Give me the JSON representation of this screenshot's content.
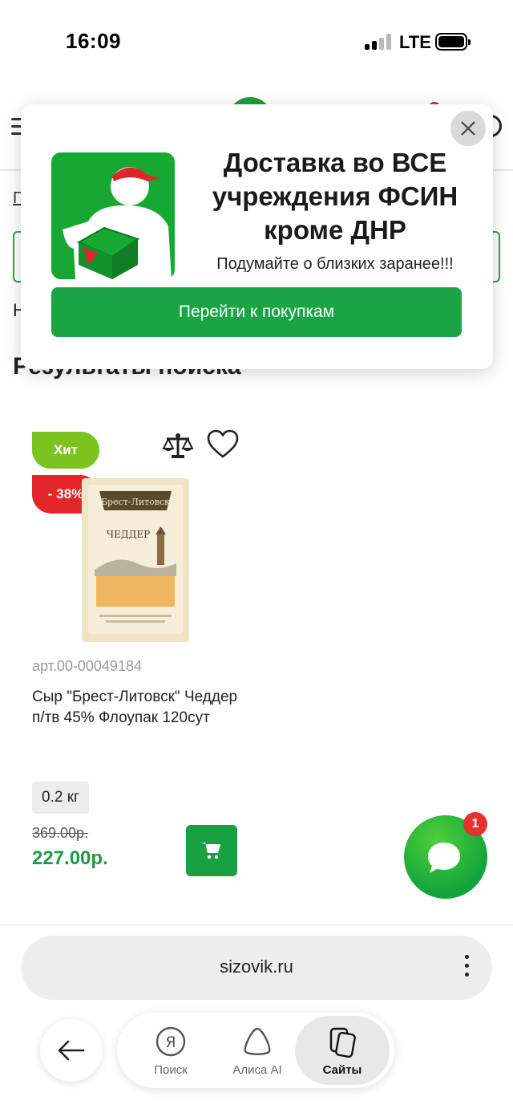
{
  "status_bar": {
    "time": "16:09",
    "network": "LTE"
  },
  "page": {
    "breadcrumb_fragment": "Г",
    "heading_fragment": "Н",
    "results_title": "Результаты поиска"
  },
  "popup": {
    "title": "Доставка во ВСЕ учреждения ФСИН кроме ДНР",
    "subtitle": "Подумайте о близких заранее!!!",
    "button_label": "Перейти к покупкам"
  },
  "product": {
    "badge_hit": "Хит",
    "badge_discount": "- 38%",
    "sku": "арт.00-00049184",
    "name": "Сыр \"Брест-Литовск\" Чеддер п/тв 45% Флоупак 120сут",
    "weight": "0.2 кг",
    "old_price": "369.00р.",
    "new_price": "227.00р.",
    "package_brand": "Брест-Литовск",
    "package_name": "ЧЕДДЕР"
  },
  "chat": {
    "badge_count": "1"
  },
  "browser": {
    "url": "sizovik.ru",
    "nav": [
      {
        "label": "Поиск",
        "icon": "yandex-search-icon"
      },
      {
        "label": "Алиса AI",
        "icon": "alice-icon"
      },
      {
        "label": "Сайты",
        "icon": "sites-icon"
      }
    ]
  },
  "colors": {
    "brand_green": "#1aa443",
    "hit_badge": "#7dc31f",
    "discount_badge": "#e3262a",
    "price_green": "#1f9a47"
  }
}
